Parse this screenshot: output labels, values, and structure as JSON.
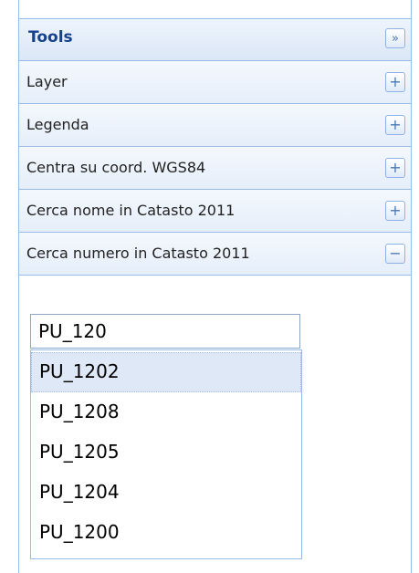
{
  "panel": {
    "title": "Tools",
    "collapse_glyph": "»"
  },
  "accordion": {
    "items": [
      {
        "label": "Layer",
        "state_glyph": "+",
        "expanded": false
      },
      {
        "label": "Legenda",
        "state_glyph": "+",
        "expanded": false
      },
      {
        "label": "Centra su coord. WGS84",
        "state_glyph": "+",
        "expanded": false
      },
      {
        "label": "Cerca nome in Catasto 2011",
        "state_glyph": "+",
        "expanded": false
      },
      {
        "label": "Cerca numero in Catasto 2011",
        "state_glyph": "−",
        "expanded": true
      }
    ]
  },
  "search": {
    "value": "PU_120",
    "suggestions": [
      "PU_1202",
      "PU_1208",
      "PU_1205",
      "PU_1204",
      "PU_1200"
    ],
    "active_suggestion": "PU_1202"
  },
  "colors": {
    "border": "#99bbe8",
    "title": "#15428b",
    "highlight": "#dfe8f6"
  }
}
